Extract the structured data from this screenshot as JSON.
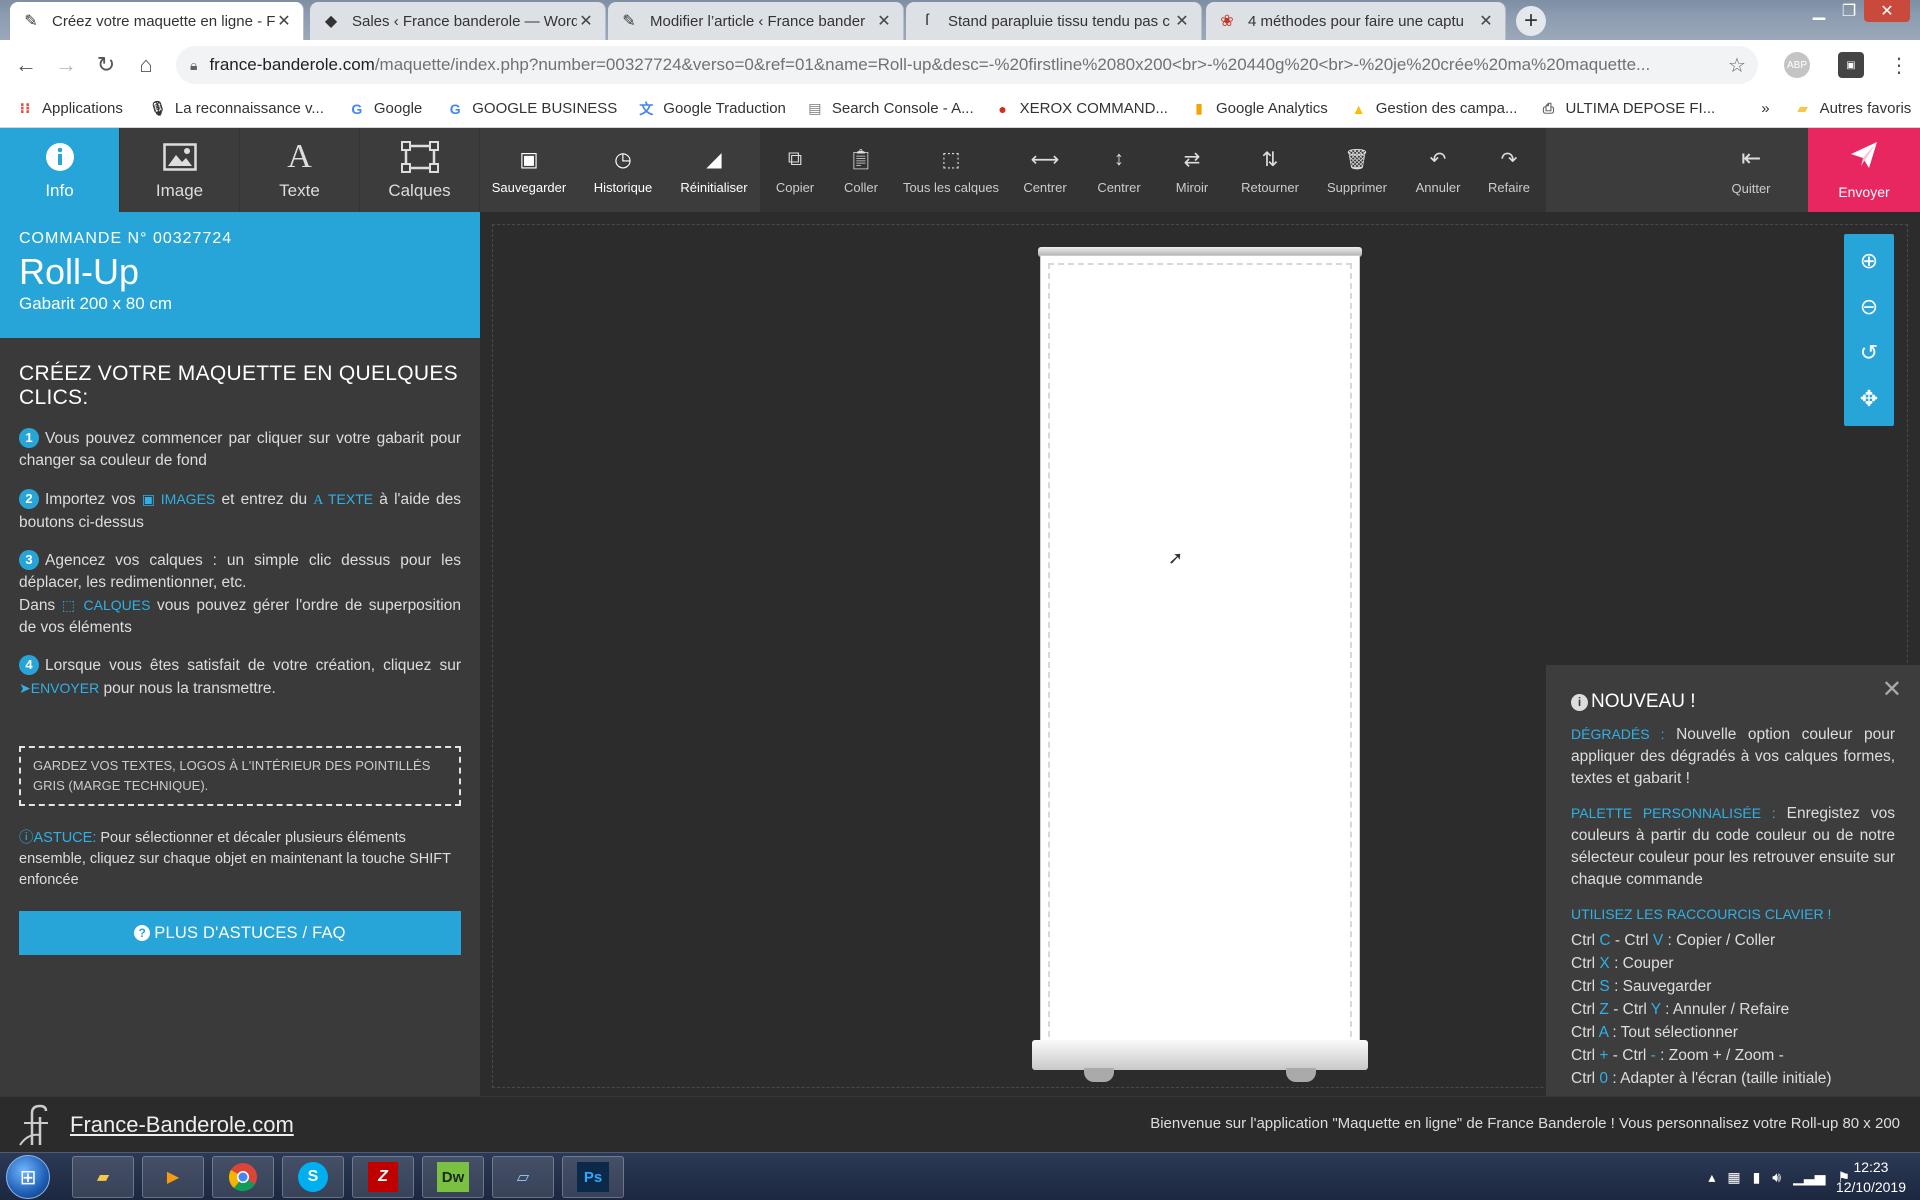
{
  "browser": {
    "tabs": [
      {
        "title": "Créez votre maquette en ligne - F",
        "icon": "pencil-icon",
        "active": true
      },
      {
        "title": "Sales ‹ France banderole — Word",
        "icon": "tag-icon",
        "active": false
      },
      {
        "title": "Modifier l’article ‹ France bander",
        "icon": "pencil-icon",
        "active": false
      },
      {
        "title": "Stand parapluie tissu tendu pas c",
        "icon": "france-banderole-logo-icon",
        "active": false
      },
      {
        "title": "4 méthodes pour faire une captu",
        "icon": "wikihow-icon",
        "active": false
      }
    ],
    "url_host": "france-banderole.com",
    "url_path": "/maquette/index.php?number=00327724&verso=0&ref=01&name=Roll-up&desc=-%20firstline%2080x200<br>-%20440g%20<br>-%20je%20crée%20ma%20maquette...",
    "bookmarks": [
      {
        "label": "Applications",
        "icon": "apps-grid-icon"
      },
      {
        "label": "La reconnaissance v...",
        "icon": "microphone-icon"
      },
      {
        "label": "Google",
        "icon": "google-icon"
      },
      {
        "label": "GOOGLE BUSINESS",
        "icon": "google-icon"
      },
      {
        "label": "Google Traduction",
        "icon": "translate-icon"
      },
      {
        "label": "Search Console - A...",
        "icon": "search-console-icon"
      },
      {
        "label": "XEROX COMMAND...",
        "icon": "xerox-icon"
      },
      {
        "label": "Google Analytics",
        "icon": "analytics-icon"
      },
      {
        "label": "Gestion des campa...",
        "icon": "google-ads-icon"
      },
      {
        "label": "ULTIMA DEPOSE FI...",
        "icon": "printer-icon"
      }
    ],
    "bookmarks_more": "»",
    "other_bookmarks": "Autres favoris"
  },
  "toolbar": {
    "main_tabs": [
      {
        "label": "Info",
        "icon": "info-icon",
        "active": true
      },
      {
        "label": "Image",
        "icon": "image-icon",
        "active": false
      },
      {
        "label": "Texte",
        "icon": "text-icon",
        "active": false
      },
      {
        "label": "Calques",
        "icon": "layers-icon",
        "active": false
      }
    ],
    "tools_light": [
      {
        "label": "Sauvegarder",
        "icon": "save-icon"
      },
      {
        "label": "Historique",
        "icon": "history-icon"
      },
      {
        "label": "Réinitialiser",
        "icon": "eraser-icon"
      }
    ],
    "tools": [
      {
        "label": "Copier",
        "icon": "copy-icon"
      },
      {
        "label": "Coller",
        "icon": "paste-icon"
      },
      {
        "label": "Tous les calques",
        "icon": "select-all-icon"
      },
      {
        "label": "Centrer",
        "icon": "center-horizontal-icon"
      },
      {
        "label": "Centrer",
        "icon": "center-vertical-icon"
      },
      {
        "label": "Miroir",
        "icon": "mirror-icon"
      },
      {
        "label": "Retourner",
        "icon": "flip-icon"
      },
      {
        "label": "Supprimer",
        "icon": "trash-icon"
      },
      {
        "label": "Annuler",
        "icon": "undo-icon"
      },
      {
        "label": "Refaire",
        "icon": "redo-icon"
      }
    ],
    "quit_label": "Quitter",
    "send_label": "Envoyer"
  },
  "sidebar": {
    "order_number": "COMMANDE N° 00327724",
    "product": "Roll-Up",
    "template": "Gabarit 200 x 80 cm",
    "heading": "CRÉEZ VOTRE MAQUETTE EN QUELQUES CLICS:",
    "steps": {
      "s1": {
        "num": "1",
        "text": "Vous pouvez commencer par cliquer sur votre gabarit pour changer sa couleur de fond"
      },
      "s2": {
        "num": "2",
        "a": "Importez vos ",
        "kw1": "IMAGES",
        "b": " et entrez du ",
        "kw2": "TEXTE",
        "c": " à l'aide des boutons ci-dessus"
      },
      "s3": {
        "num": "3",
        "a": "Agencez vos calques : un simple clic dessus pour les déplacer, les redimentionner, etc.",
        "b": "Dans ",
        "kw": "CALQUES",
        "c": " vous pouvez gérer l'ordre de superposition de vos éléments"
      },
      "s4": {
        "num": "4",
        "a": "Lorsque vous êtes satisfait de votre création, cliquez sur ",
        "kw": "ENVOYER",
        "b": " pour nous la transmettre."
      }
    },
    "notice": "GARDEZ VOS TEXTES, LOGOS À L'INTÉRIEUR DES POINTILLÉS GRIS (MARGE TECHNIQUE).",
    "tip_label": "ASTUCE:",
    "tip_text": " Pour sélectionner et décaler plusieurs éléments ensemble, cliquez sur chaque objet en maintenant la touche SHIFT enfoncée",
    "faq_button": "PLUS D'ASTUCES / FAQ"
  },
  "news": {
    "title": "NOUVEAU !",
    "p1_label": "DÉGRADÉS :",
    "p1_text": " Nouvelle option couleur pour appliquer des dégradés à vos calques formes, textes et gabarit !",
    "p2_label": "PALETTE PERSONNALISÉE :",
    "p2_text": " Enregistez vos couleurs à partir du code couleur ou de notre sélecteur couleur pour les retrouver ensuite sur chaque commande",
    "shortcuts_title": "UTILISEZ LES RACCOURCIS CLAVIER !",
    "shortcuts": [
      {
        "a": "Ctrl ",
        "k1": "C",
        "b": " - Ctrl ",
        "k2": "V",
        "c": " : Copier / Coller"
      },
      {
        "a": "Ctrl ",
        "k1": "X",
        "b": "",
        "k2": "",
        "c": " : Couper"
      },
      {
        "a": "Ctrl ",
        "k1": "S",
        "b": "",
        "k2": "",
        "c": " : Sauvegarder"
      },
      {
        "a": "Ctrl ",
        "k1": "Z",
        "b": " - Ctrl ",
        "k2": "Y",
        "c": " : Annuler / Refaire"
      },
      {
        "a": "Ctrl ",
        "k1": "A",
        "b": "",
        "k2": "",
        "c": " : Tout sélectionner"
      },
      {
        "a": "Ctrl ",
        "k1": "+",
        "b": " - Ctrl ",
        "k2": "-",
        "c": " : Zoom + / Zoom -"
      },
      {
        "a": "Ctrl ",
        "k1": "0",
        "b": "",
        "k2": "",
        "c": " : Adapter à l'écran (taille initiale)"
      }
    ]
  },
  "footer": {
    "brand": "France-Banderole.com",
    "welcome": "Bienvenue sur l'application \"Maquette en ligne\" de France Banderole ! Vous personnalisez votre Roll-up 80 x 200"
  },
  "taskbar": {
    "apps": [
      "explorer-icon",
      "media-player-icon",
      "chrome-icon",
      "skype-icon",
      "filezilla-icon",
      "dreamweaver-icon",
      "notepad-icon",
      "photoshop-icon"
    ],
    "time": "12:23",
    "date": "12/10/2019"
  },
  "colors": {
    "accent": "#28a5d8",
    "send": "#e8265f",
    "toolbar": "#3c3c3c"
  }
}
